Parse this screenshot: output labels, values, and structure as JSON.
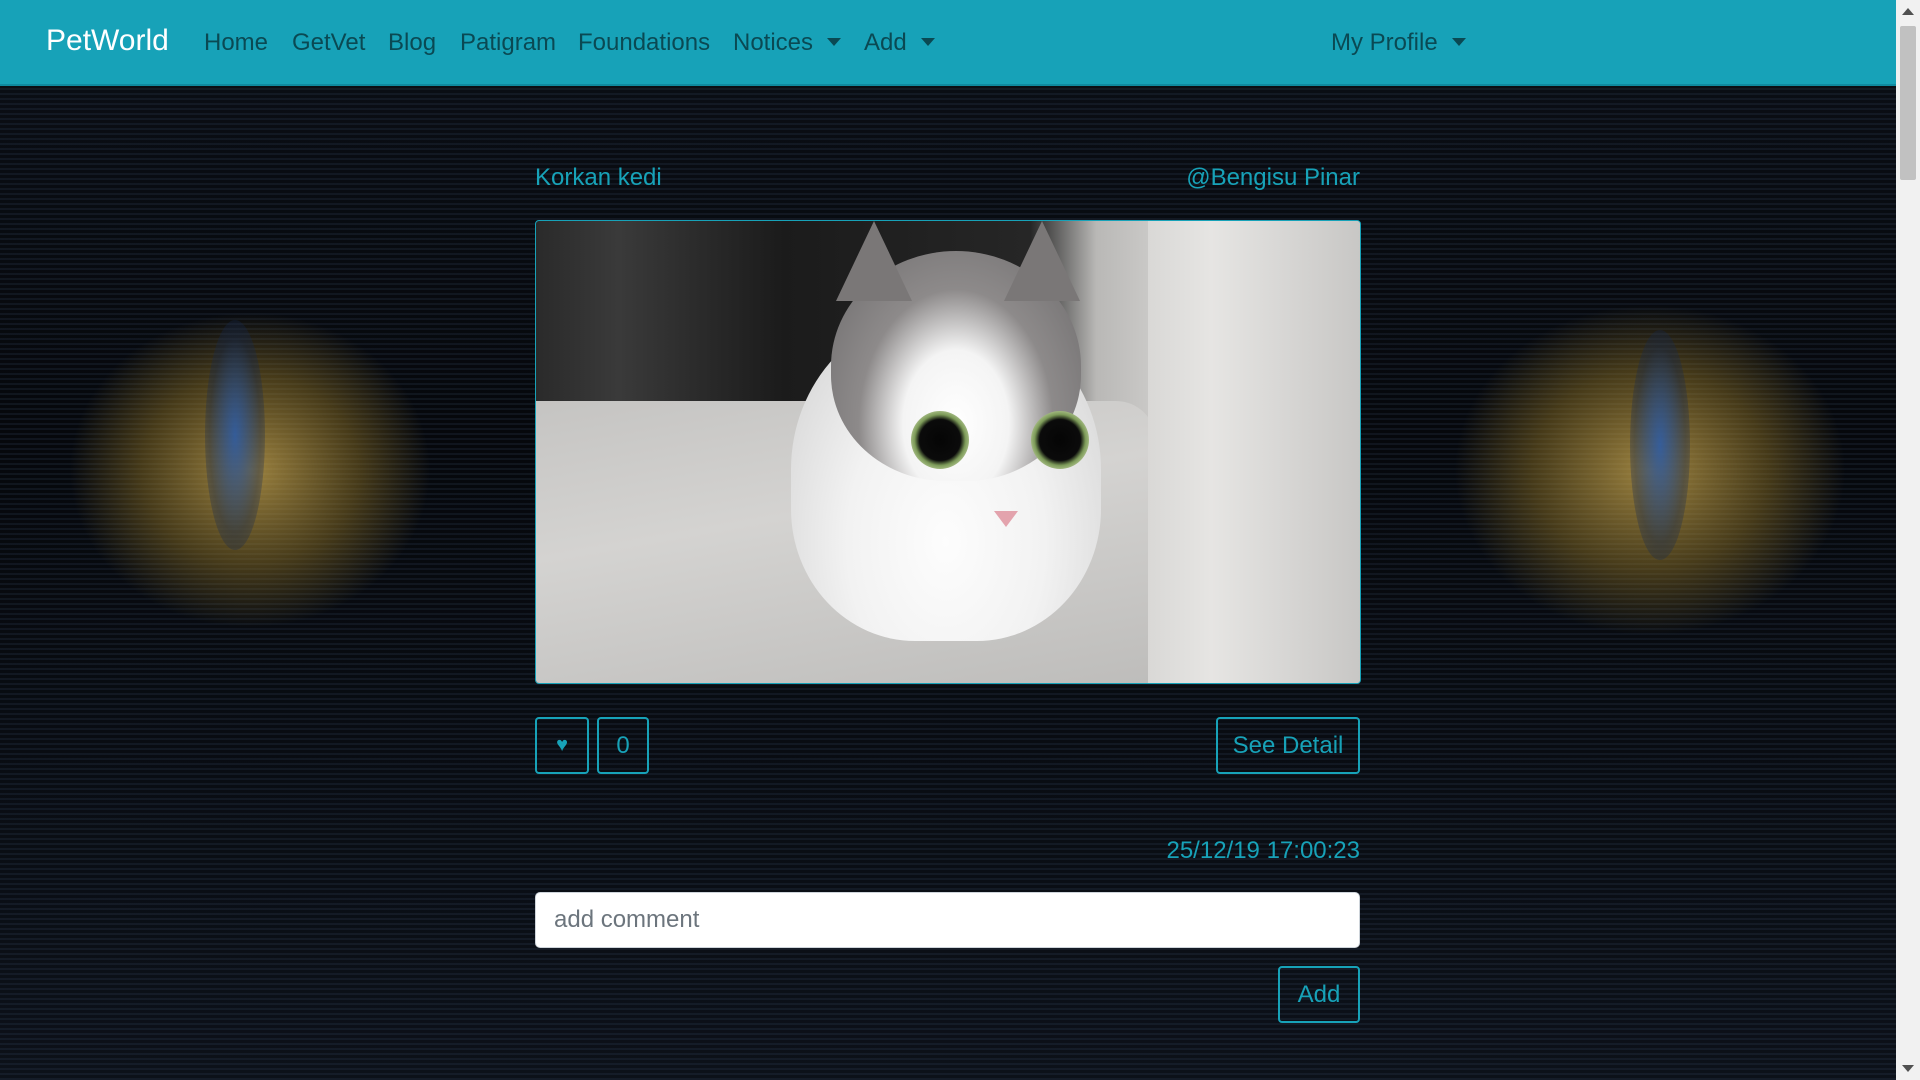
{
  "navbar": {
    "brand": "PetWorld",
    "links": [
      "Home",
      "GetVet",
      "Blog",
      "Patigram",
      "Foundations"
    ],
    "dropdowns": [
      "Notices",
      "Add"
    ],
    "profile": "My Profile"
  },
  "post": {
    "title": "Korkan kedi",
    "author": "@Bengisu Pinar",
    "like_icon": "heart-icon",
    "like_count": "0",
    "detail_label": "See Detail",
    "timestamp": "25/12/19 17:00:23"
  },
  "comment": {
    "placeholder": "add comment",
    "add_label": "Add"
  },
  "colors": {
    "accent": "#17a2b8",
    "navbar": "#17a2b8"
  }
}
